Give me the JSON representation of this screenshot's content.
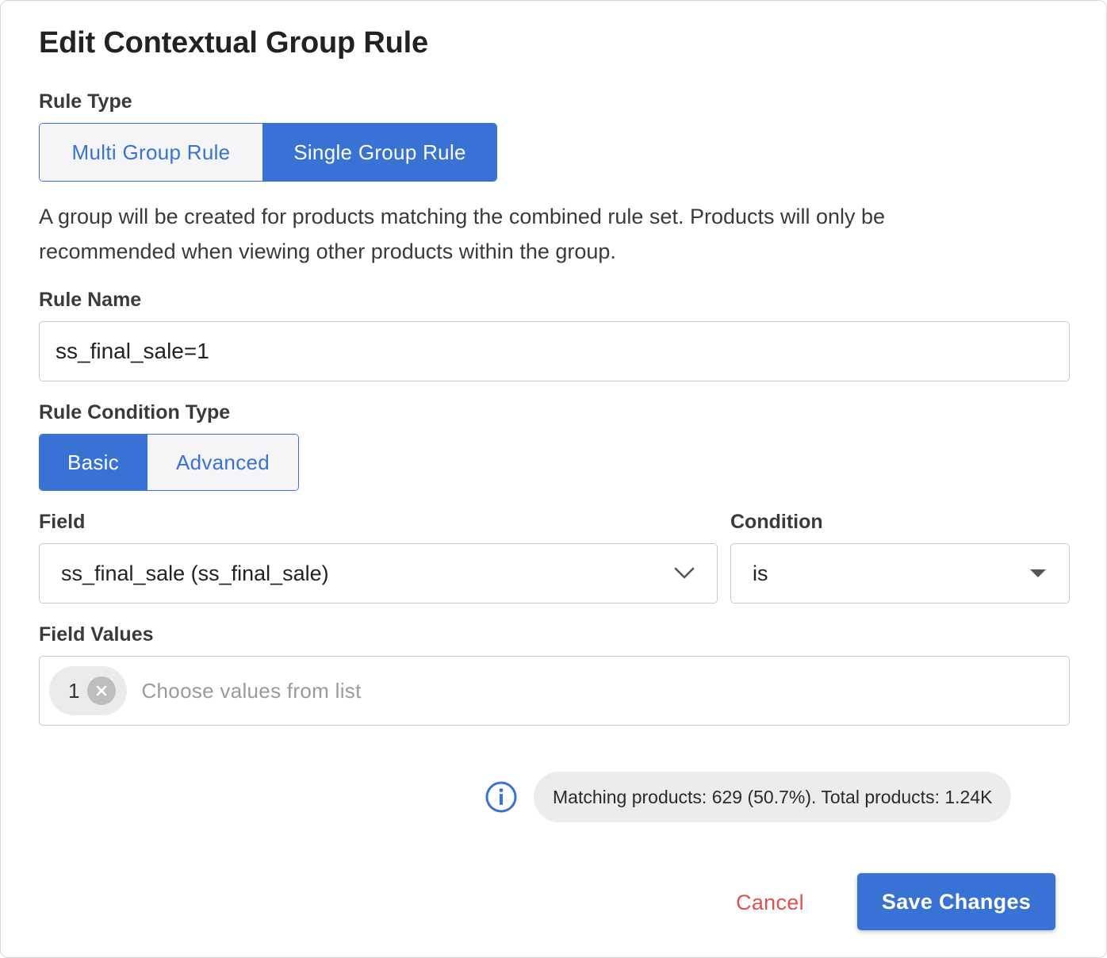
{
  "dialog": {
    "title": "Edit Contextual Group Rule"
  },
  "rule_type": {
    "label": "Rule Type",
    "options": [
      "Multi Group Rule",
      "Single Group Rule"
    ],
    "selected": "Single Group Rule",
    "description": "A group will be created for products matching the combined rule set. Products will only be recommended when viewing other products within the group."
  },
  "rule_name": {
    "label": "Rule Name",
    "value": "ss_final_sale=1"
  },
  "condition_type": {
    "label": "Rule Condition Type",
    "options": [
      "Basic",
      "Advanced"
    ],
    "selected": "Basic"
  },
  "field": {
    "label": "Field",
    "value": "ss_final_sale (ss_final_sale)",
    "icon": "chevron-down-icon"
  },
  "condition": {
    "label": "Condition",
    "value": "is",
    "icon": "caret-down-icon"
  },
  "field_values": {
    "label": "Field Values",
    "chips": [
      "1"
    ],
    "placeholder": "Choose values from list"
  },
  "matching": {
    "icon": "info-icon",
    "text": "Matching products: 629 (50.7%). Total products: 1.24K"
  },
  "actions": {
    "cancel_label": "Cancel",
    "save_label": "Save Changes"
  },
  "colors": {
    "accent": "#3872d4",
    "danger": "#e2504a",
    "badge_bg": "#ececec"
  }
}
